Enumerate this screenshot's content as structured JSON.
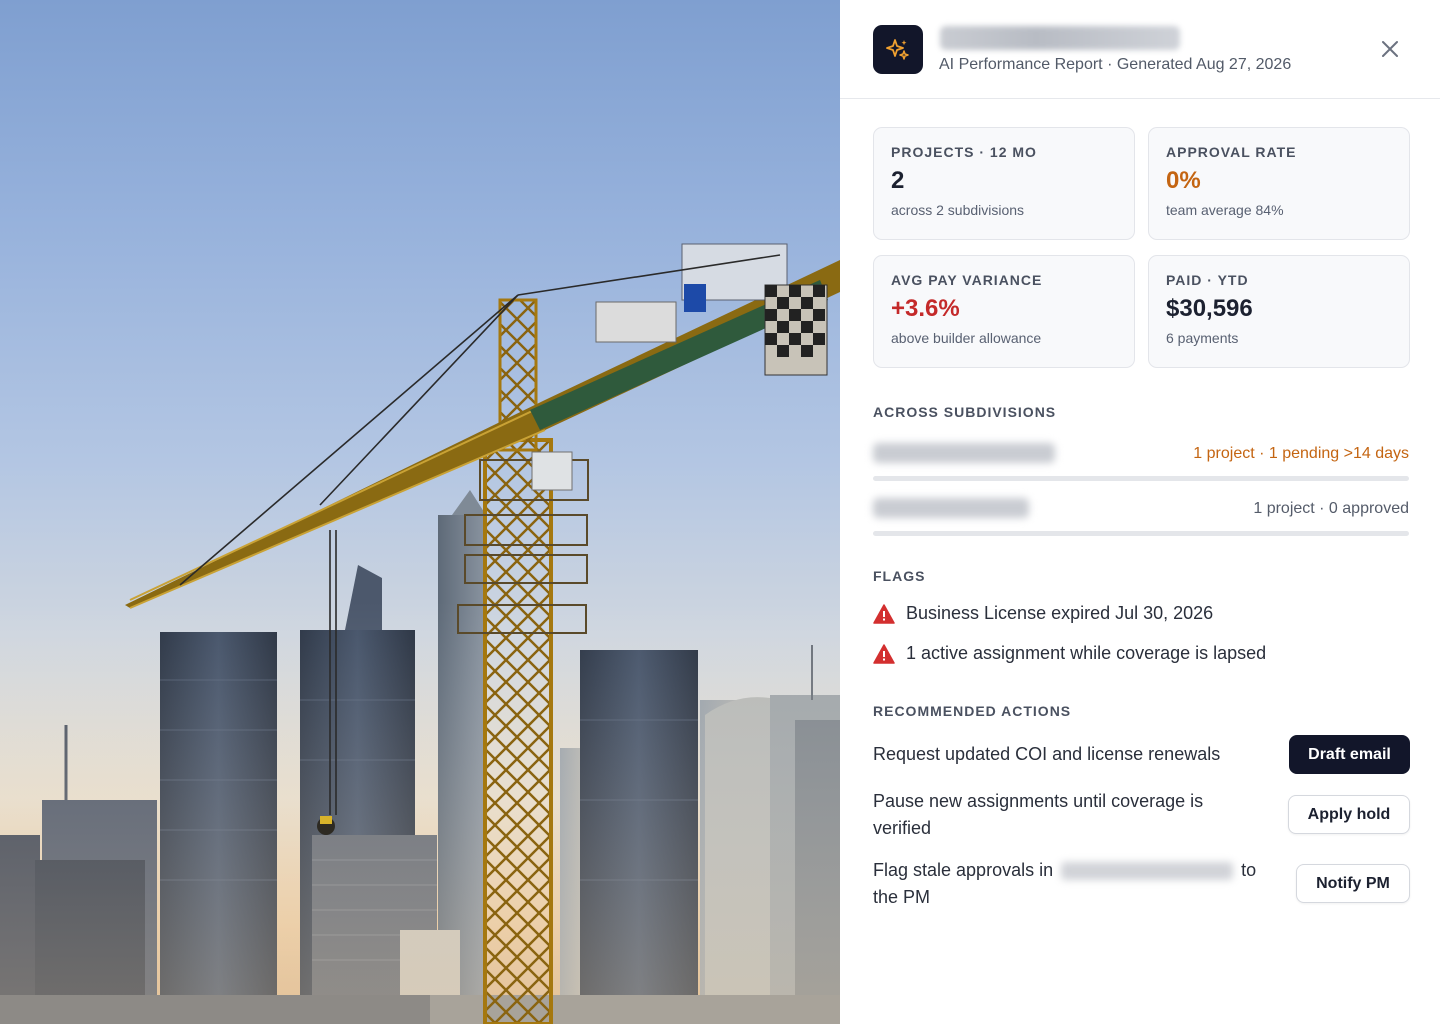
{
  "report": {
    "subtitle": "AI Performance Report · Generated Aug 27, 2026"
  },
  "photo": {
    "subject": "construction-crane-skyline-photo"
  },
  "stats": [
    {
      "label": "PROJECTS · 12 MO",
      "value": "2",
      "note": "across 2 subdivisions"
    },
    {
      "label": "APPROVAL RATE",
      "value": "0%",
      "note": "team average 84%",
      "value_color": "#c46512"
    },
    {
      "label": "AVG PAY VARIANCE",
      "value": "+3.6%",
      "note": "above builder allowance",
      "value_color": "#c42a2a"
    },
    {
      "label": "PAID · YTD",
      "value": "$30,596",
      "note": "6 payments"
    }
  ],
  "subdivisions": {
    "title": "ACROSS SUBDIVISIONS",
    "rows": [
      {
        "meta": "1 project · 1 pending >14 days",
        "meta_color": "#c46512"
      },
      {
        "meta": "1 project · 0 approved"
      }
    ]
  },
  "flags": {
    "title": "FLAGS",
    "items": [
      {
        "text": "Business License expired Jul 30, 2026",
        "icon": "warning-triangle-icon"
      },
      {
        "text": "1 active assignment while coverage is lapsed",
        "icon": "warning-triangle-icon"
      }
    ]
  },
  "actions": {
    "title": "RECOMMENDED ACTIONS",
    "items": [
      {
        "text": "Request updated COI and license renewals",
        "button": "Draft email"
      },
      {
        "text_line1": "Pause new assignments until coverage is",
        "text_line2": "verified",
        "button": "Apply hold"
      },
      {
        "text_before": "Flag stale approvals in",
        "text_after": "to",
        "text_line2": "the PM",
        "button": "Notify PM"
      }
    ]
  },
  "colors": {
    "accent_dark": "#12162a",
    "warning_orange": "#c46512",
    "alert_red": "#c42a2a",
    "sparkle_orange": "#f0a030"
  }
}
